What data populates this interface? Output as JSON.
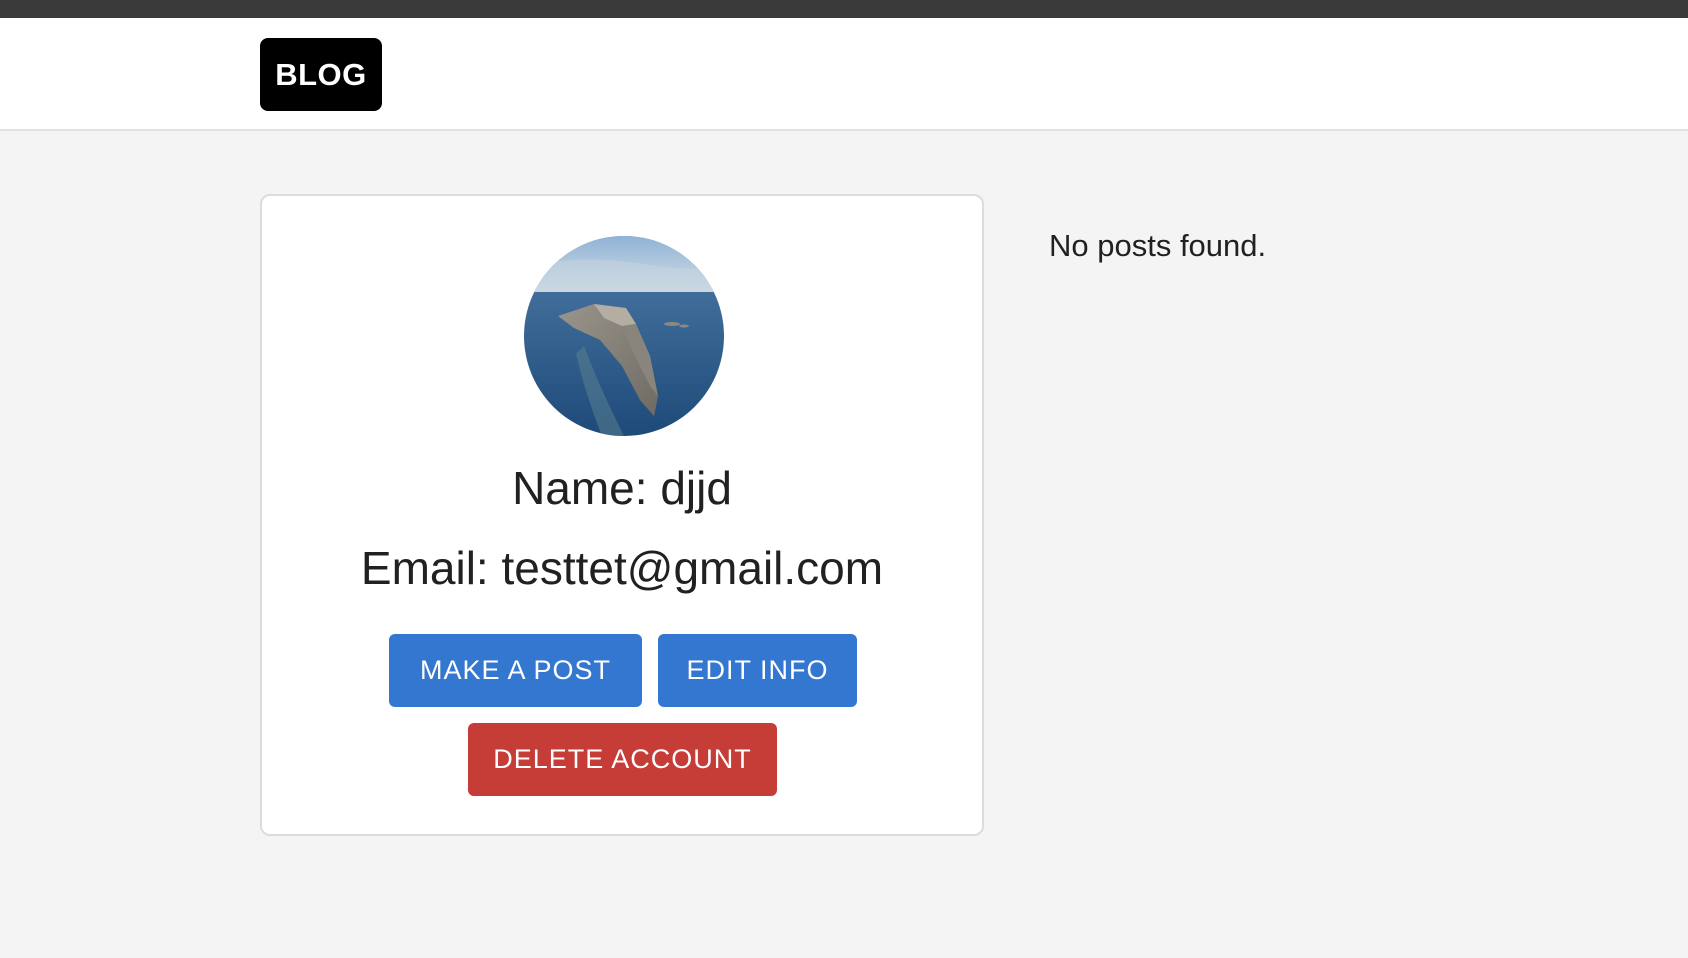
{
  "navbar": {
    "logo_label": "BLOG"
  },
  "profile": {
    "name_text": "Name: djjd",
    "email_text": "Email: testtet@gmail.com",
    "actions": {
      "make_post_label": "MAKE A POST",
      "edit_info_label": "EDIT INFO",
      "delete_account_label": "DELETE ACCOUNT"
    }
  },
  "posts": {
    "empty_message": "No posts found."
  },
  "colors": {
    "primary": "#3477d1",
    "danger": "#c63d38",
    "logo_background": "#000000",
    "page_background": "#f4f4f4"
  },
  "icons": {
    "avatar": "profile-photo-island"
  }
}
